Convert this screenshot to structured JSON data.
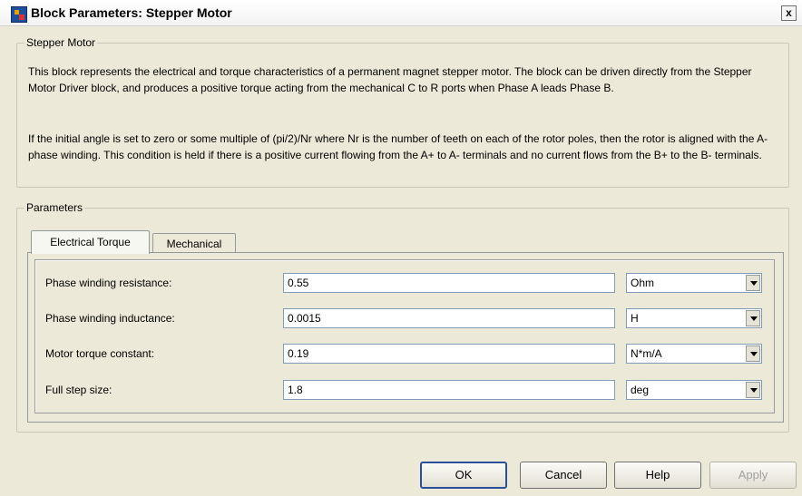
{
  "window": {
    "title": "Block Parameters: Stepper Motor",
    "close_label": "x"
  },
  "description": {
    "group_title": "Stepper Motor",
    "paragraph1": "This block represents the electrical and torque characteristics of a permanent magnet stepper motor. The block can be driven directly from the Stepper Motor Driver block, and produces a positive torque acting from the mechanical C to R ports when Phase A leads Phase B.",
    "paragraph2": "If the initial angle is set to zero or some multiple of (pi/2)/Nr where Nr is the number of teeth on each of the rotor poles, then the rotor is aligned with the A-phase winding. This condition is held if there is a positive current flowing from the A+ to A- terminals and no current flows from the B+ to the B- terminals."
  },
  "parameters": {
    "group_title": "Parameters",
    "tabs": [
      {
        "label": "Electrical Torque"
      },
      {
        "label": "Mechanical"
      }
    ],
    "rows": [
      {
        "label": "Phase winding resistance:",
        "value": "0.55",
        "unit": "Ohm"
      },
      {
        "label": "Phase winding inductance:",
        "value": "0.0015",
        "unit": "H"
      },
      {
        "label": "Motor torque constant:",
        "value": "0.19",
        "unit": "N*m/A"
      },
      {
        "label": "Full step size:",
        "value": "1.8",
        "unit": "deg"
      }
    ]
  },
  "buttons": {
    "ok": "OK",
    "cancel": "Cancel",
    "help": "Help",
    "apply": "Apply"
  }
}
